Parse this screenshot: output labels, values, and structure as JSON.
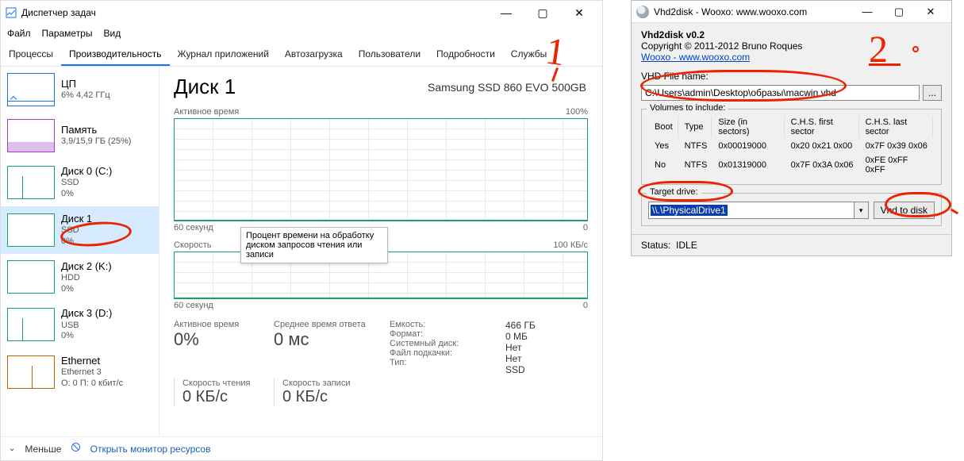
{
  "taskmgr": {
    "title": "Диспетчер задач",
    "menu": {
      "file": "Файл",
      "options": "Параметры",
      "view": "Вид"
    },
    "tabs": [
      "Процессы",
      "Производительность",
      "Журнал приложений",
      "Автозагрузка",
      "Пользователи",
      "Подробности",
      "Службы"
    ],
    "active_tab": 1,
    "sidebar": [
      {
        "name": "ЦП",
        "sub": "6% 4,42 ГГц",
        "kind": "cpu"
      },
      {
        "name": "Память",
        "sub": "3,9/15,9 ГБ (25%)",
        "kind": "mem"
      },
      {
        "name": "Диск 0 (C:)",
        "sub": "SSD",
        "sub2": "0%",
        "kind": "disk"
      },
      {
        "name": "Диск 1",
        "sub": "SSD",
        "sub2": "0%",
        "kind": "disk",
        "selected": true
      },
      {
        "name": "Диск 2 (K:)",
        "sub": "HDD",
        "sub2": "0%",
        "kind": "disk"
      },
      {
        "name": "Диск 3 (D:)",
        "sub": "USB",
        "sub2": "0%",
        "kind": "disk"
      },
      {
        "name": "Ethernet",
        "sub": "Ethernet 3",
        "sub2": "О: 0 П: 0 кбит/с",
        "kind": "eth"
      }
    ],
    "main": {
      "heading": "Диск 1",
      "device": "Samsung SSD 860 EVO 500GB",
      "chart1_label": "Активное время",
      "chart1_max": "100%",
      "chart2_label": "Скорость",
      "chart2_max": "100 КБ/с",
      "axis_left": "60 секунд",
      "axis_right": "0",
      "tooltip": "Процент времени на обработку диском запросов чтения или записи",
      "stats": {
        "active_label": "Активное время",
        "active_val": "0%",
        "avg_label": "Среднее время ответа",
        "avg_val": "0 мс",
        "read_label": "Скорость чтения",
        "read_val": "0 КБ/с",
        "write_label": "Скорость записи",
        "write_val": "0 КБ/с"
      },
      "info": {
        "capacity_l": "Емкость:",
        "capacity_v": "466 ГБ",
        "format_l": "Формат:",
        "format_v": "0 МБ",
        "sysdisk_l": "Системный диск:",
        "sysdisk_v": "Нет",
        "pagefile_l": "Файл подкачки:",
        "pagefile_v": "Нет",
        "type_l": "Тип:",
        "type_v": "SSD"
      }
    },
    "status": {
      "fewer": "Меньше",
      "monitor": "Открыть монитор ресурсов"
    }
  },
  "vhd": {
    "title": "Vhd2disk - Wooxo: www.wooxo.com",
    "header": {
      "name": "Vhd2disk v0.2",
      "copyright": "Copyright © 2011-2012 Bruno Roques",
      "link": "Wooxo - www.wooxo.com"
    },
    "file_label": "VHD File name:",
    "file_value": "C:\\Users\\admin\\Desktop\\образы\\macwin.vhd",
    "browse": "...",
    "vol_legend": "Volumes to include:",
    "vol_headers": [
      "Boot",
      "Type",
      "Size (in sectors)",
      "C.H.S. first sector",
      "C.H.S. last sector"
    ],
    "vol_rows": [
      [
        "Yes",
        "NTFS",
        "0x00019000",
        "0x20 0x21 0x00",
        "0x7F 0x39 0x06"
      ],
      [
        "No",
        "NTFS",
        "0x01319000",
        "0x7F 0x3A 0x06",
        "0xFE 0xFF 0xFF"
      ]
    ],
    "target_label": "Target drive:",
    "target_value": "\\\\.\\PhysicalDrive1",
    "go_button": "Vhd to disk",
    "status_label": "Status:",
    "status_value": "IDLE"
  }
}
